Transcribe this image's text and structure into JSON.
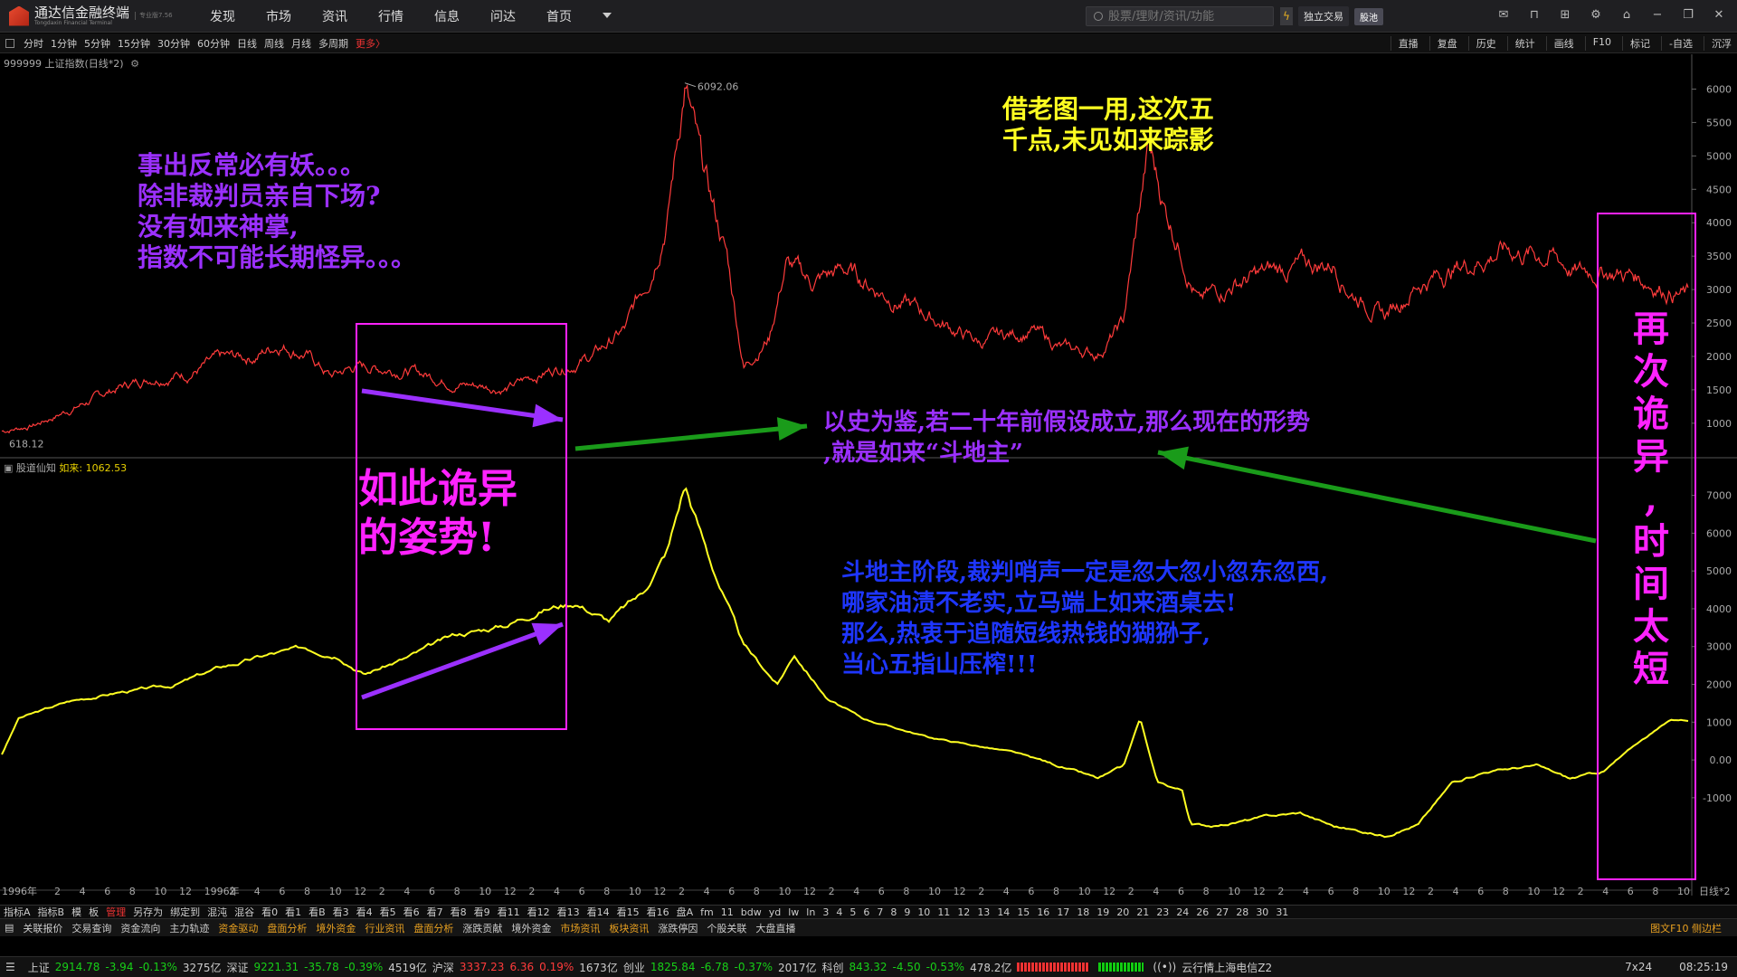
{
  "app": {
    "logo_text": "通达信金融终端",
    "logo_sub": "Tongdaxin Financial Terminal",
    "version": "专业版7.56"
  },
  "menu": [
    "发现",
    "市场",
    "资讯",
    "行情",
    "信息",
    "问达",
    "首页"
  ],
  "search": {
    "placeholder": "股票/理财/资讯/功能"
  },
  "toolbar": {
    "trade_label": "独立交易",
    "demo_label": "股池"
  },
  "periods": [
    "分时",
    "1分钟",
    "5分钟",
    "15分钟",
    "30分钟",
    "60分钟",
    "日线",
    "周线",
    "月线",
    "多周期"
  ],
  "periods_more": "更多〉",
  "right_tools": [
    "直播",
    "复盘",
    "历史",
    "统计",
    "画线",
    "F10",
    "标记",
    "-自选",
    "沉浮"
  ],
  "main_panel": {
    "title": "999999 上证指数(日线*2)",
    "high_label": "6092.06",
    "low_label": "618.12"
  },
  "sub_panel": {
    "title": "股道仙知",
    "series_label": "如来:",
    "series_value": "1062.53"
  },
  "price_axis": [
    "6000",
    "5500",
    "5000",
    "4500",
    "4000",
    "3500",
    "3000",
    "2500",
    "2000",
    "1500",
    "1000"
  ],
  "sub_axis": [
    "7000",
    "6000",
    "5000",
    "4000",
    "3000",
    "2000",
    "1000",
    "0.00",
    "-1000"
  ],
  "time_axis_first": "1996年",
  "time_axis_last": "日线*2",
  "time_ticks": [
    "2",
    "4",
    "6",
    "8",
    "10",
    "12",
    "1996年",
    "2",
    "4",
    "6",
    "8",
    "10",
    "12",
    "2",
    "4",
    "6",
    "8",
    "10",
    "12",
    "2",
    "4",
    "6",
    "8",
    "10",
    "12",
    "2",
    "4",
    "6",
    "8",
    "10",
    "12",
    "2",
    "4",
    "6",
    "8",
    "10",
    "12",
    "2",
    "4",
    "6",
    "8",
    "10",
    "12",
    "2",
    "4",
    "6",
    "8",
    "10",
    "12",
    "2",
    "4",
    "6",
    "8",
    "10",
    "12",
    "2",
    "4",
    "6",
    "8",
    "10",
    "12",
    "2",
    "4",
    "6",
    "8",
    "10",
    "12"
  ],
  "annotations": {
    "top_left": "事出反常必有妖。。。\n除非裁判员亲自下场?\n没有如来神掌,\n指数不可能长期怪异。。。",
    "top_center": "借老图一用,这次五\n千点,未见如来踪影",
    "box_left": "如此诡异\n的姿势!",
    "middle": "以史为鉴,若二十年前假设成立,那么现在的形势\n,就是如来“斗地主”",
    "lower": "斗地主阶段,裁判哨声一定是忽大忽小忽东忽西,\n哪家油渍不老实,立马端上如来酒桌去!\n那么,热衷于追随短线热钱的猢狲子,\n当心五指山压榨!!!",
    "box_right": "再\n次\n诡\n异\n,\n时\n间\n太\n短"
  },
  "indicator_bar": [
    "指标A",
    "指标B",
    "模",
    "板",
    "管理",
    "另存为",
    "绑定到",
    "混沌",
    "混谷",
    "看0",
    "看1",
    "看B",
    "看3",
    "看4",
    "看5",
    "看6",
    "看7",
    "看8",
    "看9",
    "看11",
    "看12",
    "看13",
    "看14",
    "看15",
    "看16",
    "盘A",
    "fm",
    "11",
    "bdw",
    "yd",
    "lw",
    "ln",
    "3",
    "4",
    "5",
    "6",
    "7",
    "8",
    "9",
    "10",
    "11",
    "12",
    "13",
    "14",
    "15",
    "16",
    "17",
    "18",
    "19",
    "20",
    "21",
    "23",
    "24",
    "26",
    "27",
    "28",
    "30",
    "31"
  ],
  "tabs": [
    {
      "label": "关联报价",
      "c": "w"
    },
    {
      "label": "交易查询",
      "c": "w"
    },
    {
      "label": "资金流向",
      "c": "w"
    },
    {
      "label": "主力轨迹",
      "c": "w"
    },
    {
      "label": "资金驱动",
      "c": "o"
    },
    {
      "label": "盘面分析",
      "c": "o"
    },
    {
      "label": "境外资金",
      "c": "o"
    },
    {
      "label": "行业资讯",
      "c": "o"
    },
    {
      "label": "盘面分析",
      "c": "o"
    },
    {
      "label": "涨跌贡献",
      "c": "w"
    },
    {
      "label": "境外资金",
      "c": "w"
    },
    {
      "label": "市场资讯",
      "c": "o"
    },
    {
      "label": "板块资讯",
      "c": "o"
    },
    {
      "label": "涨跌停因",
      "c": "w"
    },
    {
      "label": "个股关联",
      "c": "w"
    },
    {
      "label": "大盘直播",
      "c": "w"
    }
  ],
  "tabs_right": "图文F10 侧边栏",
  "status": [
    {
      "name": "上证",
      "price": "2914.78",
      "chg": "-3.94",
      "pct": "-0.13%",
      "amt": "3275亿",
      "dir": "dn"
    },
    {
      "name": "深证",
      "price": "9221.31",
      "chg": "-35.78",
      "pct": "-0.39%",
      "amt": "4519亿",
      "dir": "dn"
    },
    {
      "name": "沪深",
      "price": "3337.23",
      "chg": "6.36",
      "pct": "0.19%",
      "amt": "1673亿",
      "dir": "up"
    },
    {
      "name": "创业",
      "price": "1825.84",
      "chg": "-6.78",
      "pct": "-0.37%",
      "amt": "2017亿",
      "dir": "dn"
    },
    {
      "name": "科创",
      "price": "843.32",
      "chg": "-4.50",
      "pct": "-0.53%",
      "amt": "478.2亿",
      "dir": "dn"
    }
  ],
  "status_server": "云行情上海电信Z2",
  "status_mode": "7x24",
  "status_time": "08:25:19",
  "chart_data": {
    "type": "line",
    "series": [
      {
        "name": "上证指数",
        "color": "#ff3b3b",
        "panel": "main"
      },
      {
        "name": "如来",
        "color": "#ffff22",
        "panel": "sub"
      }
    ],
    "main_ylim": [
      700,
      6250
    ],
    "sub_ylim": [
      -2200,
      7900
    ],
    "main_high": 6092.06,
    "main_low": 618.12,
    "sub_last": 1062.53,
    "main_keypoints": [
      [
        0,
        880
      ],
      [
        0.02,
        980
      ],
      [
        0.04,
        1200
      ],
      [
        0.07,
        1540
      ],
      [
        0.09,
        1700
      ],
      [
        0.11,
        1750
      ],
      [
        0.13,
        1950
      ],
      [
        0.15,
        2000
      ],
      [
        0.165,
        2200
      ],
      [
        0.18,
        2050
      ],
      [
        0.195,
        1700
      ],
      [
        0.21,
        1850
      ],
      [
        0.24,
        1800
      ],
      [
        0.27,
        1600
      ],
      [
        0.3,
        1520
      ],
      [
        0.32,
        1750
      ],
      [
        0.35,
        2000
      ],
      [
        0.37,
        2400
      ],
      [
        0.385,
        3300
      ],
      [
        0.395,
        4200
      ],
      [
        0.405,
        6092
      ],
      [
        0.415,
        4800
      ],
      [
        0.43,
        3500
      ],
      [
        0.44,
        1850
      ],
      [
        0.455,
        2300
      ],
      [
        0.465,
        3400
      ],
      [
        0.48,
        3100
      ],
      [
        0.5,
        3300
      ],
      [
        0.52,
        3000
      ],
      [
        0.55,
        2600
      ],
      [
        0.58,
        2200
      ],
      [
        0.61,
        2400
      ],
      [
        0.63,
        2100
      ],
      [
        0.65,
        2050
      ],
      [
        0.665,
        2500
      ],
      [
        0.68,
        5100
      ],
      [
        0.69,
        4200
      ],
      [
        0.7,
        3600
      ],
      [
        0.71,
        2800
      ],
      [
        0.73,
        3100
      ],
      [
        0.76,
        3300
      ],
      [
        0.79,
        3400
      ],
      [
        0.8,
        3000
      ],
      [
        0.82,
        2600
      ],
      [
        0.84,
        3100
      ],
      [
        0.87,
        3400
      ],
      [
        0.89,
        3600
      ],
      [
        0.92,
        3500
      ],
      [
        0.935,
        3250
      ],
      [
        0.95,
        3300
      ],
      [
        0.97,
        3200
      ],
      [
        1.0,
        2900
      ]
    ],
    "sub_keypoints": [
      [
        0,
        150
      ],
      [
        0.01,
        1100
      ],
      [
        0.04,
        1550
      ],
      [
        0.07,
        1800
      ],
      [
        0.1,
        1950
      ],
      [
        0.13,
        2450
      ],
      [
        0.16,
        2800
      ],
      [
        0.18,
        2950
      ],
      [
        0.2,
        2800
      ],
      [
        0.215,
        2300
      ],
      [
        0.24,
        2700
      ],
      [
        0.27,
        3300
      ],
      [
        0.3,
        3600
      ],
      [
        0.32,
        4000
      ],
      [
        0.34,
        4200
      ],
      [
        0.36,
        3700
      ],
      [
        0.38,
        4400
      ],
      [
        0.395,
        5600
      ],
      [
        0.405,
        7300
      ],
      [
        0.42,
        5300
      ],
      [
        0.44,
        3000
      ],
      [
        0.46,
        2000
      ],
      [
        0.47,
        2800
      ],
      [
        0.49,
        1600
      ],
      [
        0.51,
        1100
      ],
      [
        0.55,
        600
      ],
      [
        0.6,
        200
      ],
      [
        0.63,
        -200
      ],
      [
        0.65,
        -500
      ],
      [
        0.665,
        -200
      ],
      [
        0.675,
        1100
      ],
      [
        0.685,
        -600
      ],
      [
        0.7,
        -800
      ],
      [
        0.705,
        -1700
      ],
      [
        0.72,
        -1750
      ],
      [
        0.75,
        -1500
      ],
      [
        0.77,
        -1400
      ],
      [
        0.79,
        -1750
      ],
      [
        0.82,
        -2000
      ],
      [
        0.84,
        -1700
      ],
      [
        0.86,
        -600
      ],
      [
        0.88,
        -300
      ],
      [
        0.91,
        -150
      ],
      [
        0.93,
        -500
      ],
      [
        0.95,
        -300
      ],
      [
        0.97,
        450
      ],
      [
        0.99,
        1062
      ]
    ]
  }
}
